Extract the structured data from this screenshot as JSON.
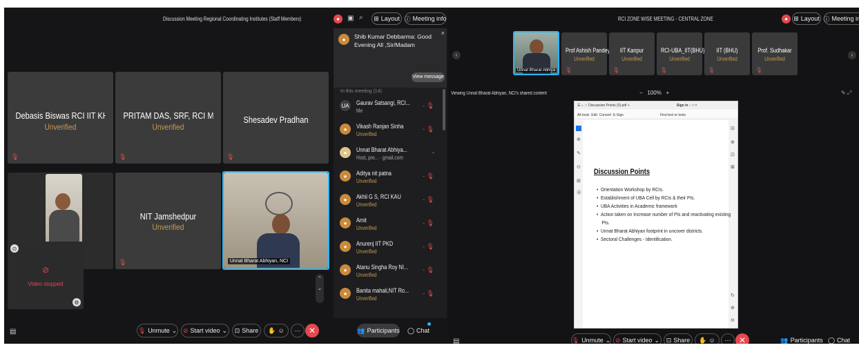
{
  "left_window": {
    "title": "Discussion Meeting Regional Coordinating Institutes (Staff Members)",
    "layout_label": "Layout",
    "meeting_info_label": "Meeting info",
    "tiles": [
      {
        "name": "Debasis Biswas RCI IIT KH...",
        "status": "Unverified"
      },
      {
        "name": "PRITAM DAS, SRF, RCI MP...",
        "status": "Unverified"
      },
      {
        "name": "Shesadev Pradhan",
        "status": ""
      },
      {
        "name": "NIT Jamshedpur",
        "status": "Unverified"
      }
    ],
    "active_speaker_label": "Unnat Bharat Abhiyan, NCI",
    "video_stopped_label": "Video stopped",
    "toolbar": {
      "unmute": "Unmute",
      "start_video": "Start video",
      "share": "Share"
    },
    "chat_notification": {
      "text": "Shib Kumar Debbarma: Good Evening All ,Sir/Madam",
      "view_button": "View message",
      "cancel": "Cancel",
      "search": "Search",
      "section": "In this meeting (14)"
    },
    "participants": [
      {
        "initials": "UA",
        "name": "Gaurav Satsangi, RCI...",
        "status": "Me"
      },
      {
        "initials": "",
        "name": "Vikash Ranjan Sinha",
        "status": "Unverified"
      },
      {
        "initials": "",
        "name": "Unnat Bharat Abhiya...",
        "status": "Host, pre... · gmail.com"
      },
      {
        "initials": "",
        "name": "Aditya nit patna",
        "status": "Unverified"
      },
      {
        "initials": "",
        "name": "Akhil G S, RCI KAU",
        "status": "Unverified"
      },
      {
        "initials": "",
        "name": "Amit",
        "status": "Unverified"
      },
      {
        "initials": "",
        "name": "Anurenj IIT PKD",
        "status": "Unverified"
      },
      {
        "initials": "",
        "name": "Atanu Singha Roy NI...",
        "status": "Unverified"
      },
      {
        "initials": "",
        "name": "Banita mahali,NIT Ro...",
        "status": "Unverified"
      }
    ],
    "participants_button": "Participants",
    "chat_button": "Chat"
  },
  "right_window": {
    "title": "RCI ZONE WISE MEETING - CENTRAL ZONE",
    "layout_label": "Layout",
    "meeting_info_label": "Meeting info",
    "active_label": "Unnat Bharat Abhiya",
    "participants_strip": [
      {
        "name": "Prof Ashish Pandey",
        "status": "Unverified"
      },
      {
        "name": "IIT Kanpur",
        "status": "Unverified"
      },
      {
        "name": "RCI-UBA_IIT(BHU)",
        "status": "Unverified"
      },
      {
        "name": "IIT (BHU)",
        "status": "Unverified"
      },
      {
        "name": "Prof. Sudhakar",
        "status": "Unverified"
      }
    ],
    "viewing_text": "Viewing Unnat Bharat Abhiyan, NCI's shared content",
    "zoom": "100%",
    "doc": {
      "tab": "Discussion Points (3).pdf",
      "menu": [
        "All tools",
        "Edit",
        "Convert",
        "E-Sign"
      ],
      "find_text": "Find text or tools",
      "sign_in": "Sign in",
      "heading": "Discussion Points",
      "bullets": [
        "Orientation Workshop by RCIs.",
        "Establishment of UBA Cell by RCIs & their PIs.",
        "UBA Activities in Academic framework",
        "Action taken on Increase number of PIs and reactivating existing",
        "PIs.",
        "Unnat Bharat Abhiyan footprint in uncover districts.",
        "Sectoral Challenges - Identification."
      ]
    },
    "toolbar": {
      "unmute": "Unmute",
      "start_video": "Start video",
      "share": "Share"
    },
    "participants_button": "Participants",
    "chat_button": "Chat"
  },
  "colors": {
    "unverified": "#c99a4b",
    "leave": "#e5484d",
    "active_border": "#29b6f6"
  }
}
